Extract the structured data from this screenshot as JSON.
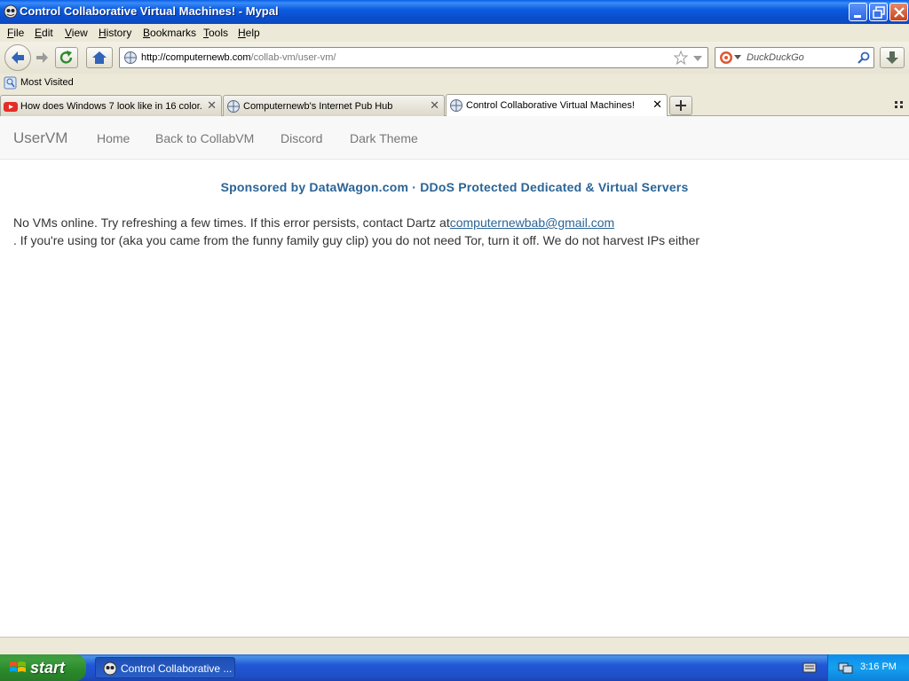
{
  "window": {
    "title": "Control Collaborative Virtual Machines! - Mypal"
  },
  "menu": {
    "items": [
      {
        "key": "F",
        "rest": "ile"
      },
      {
        "key": "E",
        "rest": "dit"
      },
      {
        "key": "V",
        "rest": "iew"
      },
      {
        "key": "H",
        "rest": "istory"
      },
      {
        "key": "B",
        "rest": "ookmarks"
      },
      {
        "key": "T",
        "rest": "ools"
      },
      {
        "key": "H",
        "rest": "elp"
      }
    ]
  },
  "navbar": {
    "url_host": "http://computernewb.com",
    "url_path": "/collab-vm/user-vm/",
    "search_placeholder": "DuckDuckGo"
  },
  "bookmarks": {
    "most_visited": "Most Visited"
  },
  "tabs": [
    {
      "label": "How does Windows 7 look like in 16 color...",
      "icon": "youtube-icon"
    },
    {
      "label": "Computernewb's Internet Pub Hub",
      "icon": "globe-icon"
    },
    {
      "label": "Control Collaborative Virtual Machines!",
      "icon": "globe-icon"
    }
  ],
  "site": {
    "brand": "UserVM",
    "nav": [
      "Home",
      "Back to CollabVM",
      "Discord",
      "Dark Theme"
    ],
    "sponsor": "Sponsored by DataWagon.com · DDoS Protected Dedicated & Virtual Servers",
    "message_prefix": "No VMs online. Try refreshing a few times. If this error persists, contact Dartz at",
    "email": "computernewbab@gmail.com",
    "message_line2": ". If you're using tor (aka you came from the funny family guy clip) you do not need Tor, turn it off. We do not harvest IPs either"
  },
  "taskbar": {
    "start": "start",
    "window_label": "Control Collaborative ...",
    "clock": "3:16 PM"
  },
  "colors": {
    "link": "#2a6496",
    "titlebar": "#0a4fd0",
    "taskbar": "#2157d7"
  }
}
